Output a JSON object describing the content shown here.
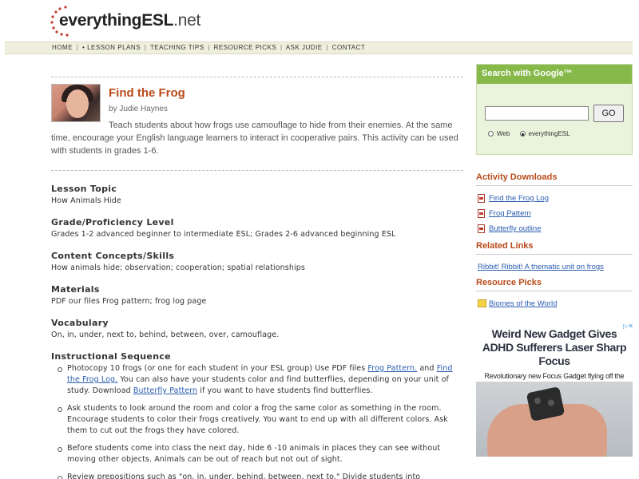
{
  "site": {
    "logo_main": "everythingESL",
    "logo_ext": ".net"
  },
  "nav": {
    "items": [
      "HOME",
      "• LESSON PLANS",
      "TEACHING TIPS",
      "RESOURCE PICKS",
      "ASK JUDIE",
      "CONTACT"
    ],
    "separator": "|"
  },
  "article": {
    "title": "Find the Frog",
    "byline": "by Judie Haynes",
    "intro": "Teach students about how frogs use camouflage to hide from their enemies. At the same time, encourage your English language learners to interact in cooperative pairs. This activity can be used with students in grades 1-6.",
    "sections": [
      {
        "heading": "Lesson Topic",
        "body": "How Animals Hide"
      },
      {
        "heading": "Grade/Proficiency Level",
        "body": "Grades 1-2 advanced beginner to intermediate ESL; Grades 2-6 advanced beginning ESL"
      },
      {
        "heading": "Content Concepts/Skills",
        "body": "How animals hide; observation; cooperation; spatial relationships"
      },
      {
        "heading": "Materials",
        "body": "PDF our files Frog pattern; frog log page"
      },
      {
        "heading": "Vocabulary",
        "body": "On, in, under, next to, behind, between, over, camouflage."
      }
    ],
    "sequence_heading": "Instructional Sequence",
    "steps": {
      "step1_a": "Photocopy 10 frogs (or one for each student in your ESL group) Use PDF files ",
      "step1_link1": "Frog Pattern.",
      "step1_b": " and ",
      "step1_link2": "Find the Frog Log.",
      "step1_c": " You can also have your students color and find butterflies, depending on your unit of study. Download ",
      "step1_link3": "Butterfly Pattern",
      "step1_d": " if you want to have students find butterflies.",
      "step2": "Ask students to look around the room and color a frog the same color as something in the room. Encourage students to color their frogs creatively. You want to end up with all different colors. Ask them to cut out the frogs they have colored.",
      "step3": "Before students come into class the next day, hide 6 -10 animals in places they can see without moving other objects. Animals can be out of reach but not out of sight.",
      "step4": "Review prepositions such as \"on, in, under, behind, between, next to.\" Divide students into"
    }
  },
  "sidebar": {
    "google_heading": "Search with Google™",
    "search_value": "",
    "go_label": "GO",
    "radio_web": "Web",
    "radio_site": "everythingESL",
    "downloads_heading": "Activity Downloads",
    "downloads": [
      "Find the Frog Log",
      "Frog Pattern",
      "Butterfly outline"
    ],
    "related_heading": "Related Links",
    "related": [
      "Ribbit! Ribbit! A thematic unit on frogs"
    ],
    "picks_heading": "Resource Picks",
    "picks": [
      "Biomes of the World"
    ]
  },
  "ad": {
    "title": "Weird New Gadget Gives ADHD Sufferers Laser Sharp Focus",
    "body": "Revolutionary new Focus Gadget flying off the shelves after finally being released to public.",
    "icon": "ad-choices-icon"
  },
  "colors": {
    "accent": "#b84a1a",
    "link": "#2a5db0",
    "google_green": "#86b84a",
    "nav_bg": "#efefde"
  }
}
